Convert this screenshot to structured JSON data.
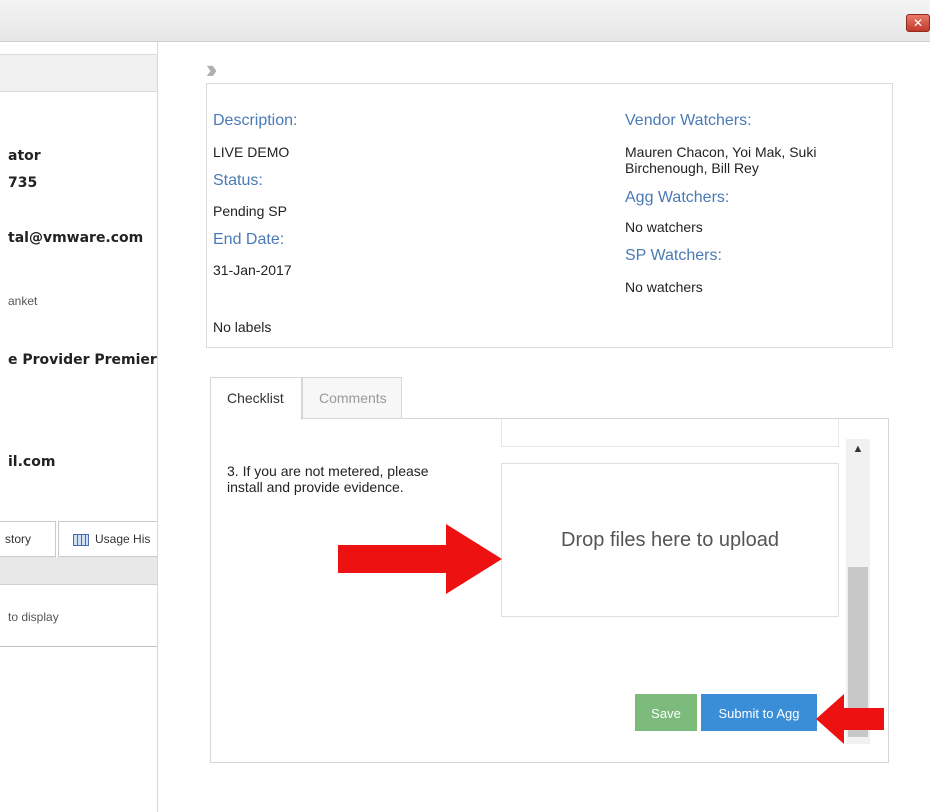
{
  "window": {
    "close_label": "✕"
  },
  "left_panel": {
    "line1": "ator",
    "line2": "735",
    "email1": "tal@vmware.com",
    "line4": "anket",
    "program": "e Provider Premier - I",
    "email2": "il.com",
    "tab_history": "story",
    "tab_usage": "Usage His",
    "empty_msg": "to display"
  },
  "details": {
    "description_label": "Description:",
    "description_value": "LIVE DEMO",
    "status_label": "Status:",
    "status_value": "Pending SP",
    "end_date_label": "End Date:",
    "end_date_value": "31-Jan-2017",
    "labels_value": "No labels",
    "vendor_watchers_label": "Vendor Watchers:",
    "vendor_watchers_value": "Mauren Chacon, Yoi Mak, Suki Birchenough, Bill Rey",
    "agg_watchers_label": "Agg Watchers:",
    "agg_watchers_value": "No watchers",
    "sp_watchers_label": "SP Watchers:",
    "sp_watchers_value": "No watchers"
  },
  "tabs": [
    {
      "label": "Checklist",
      "active": true
    },
    {
      "label": "Comments",
      "active": false
    }
  ],
  "checklist": {
    "item_text": "3. If you are not metered, please install and provide evidence.",
    "dropzone_text": "Drop files here to upload",
    "save_label": "Save",
    "submit_label": "Submit to Agg"
  },
  "colors": {
    "label_blue": "#4a7ab5",
    "save_green": "#7dbb7d",
    "submit_blue": "#3a8ed8",
    "annotation_red": "#ee1111"
  }
}
